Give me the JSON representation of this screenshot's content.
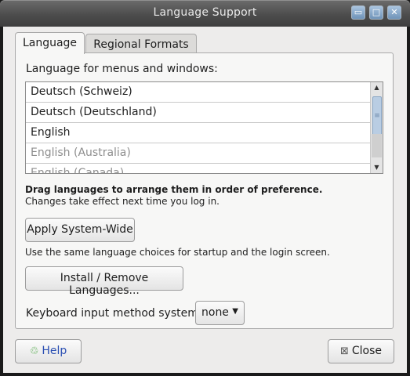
{
  "window": {
    "title": "Language Support",
    "controls": {
      "minimize": "▭",
      "maximize": "□",
      "close": "✕"
    }
  },
  "tabs": [
    {
      "label": "Language",
      "active": true
    },
    {
      "label": "Regional Formats",
      "active": false
    }
  ],
  "language_section": {
    "label": "Language for menus and windows:",
    "languages": [
      {
        "name": "Deutsch (Schweiz)",
        "dimmed": false
      },
      {
        "name": "Deutsch (Deutschland)",
        "dimmed": false
      },
      {
        "name": "English",
        "dimmed": false
      },
      {
        "name": "English (Australia)",
        "dimmed": true
      },
      {
        "name": "English (Canada)",
        "dimmed": true
      }
    ],
    "drag_hint": "Drag languages to arrange them in order of preference.",
    "effect_hint": "Changes take effect next time you log in."
  },
  "buttons": {
    "apply_system_wide": "Apply System-Wide",
    "same_choices_hint": "Use the same language choices for startup and the login screen.",
    "install_remove": "Install / Remove Languages...",
    "help": "Help",
    "close": "Close"
  },
  "keyboard": {
    "label": "Keyboard input method system:",
    "selected": "none"
  },
  "icons": {
    "help": "help-icon",
    "close": "close-icon"
  }
}
